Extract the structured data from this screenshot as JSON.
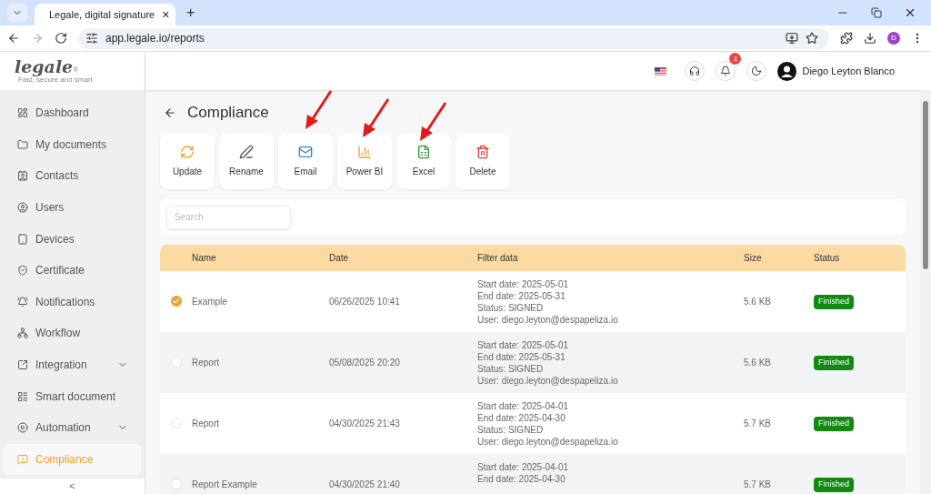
{
  "browser": {
    "tab_title": "Legale, digital signature",
    "tab_close": "×",
    "new_tab": "+",
    "url": "app.legale.io/reports",
    "profile": "D"
  },
  "logo": {
    "text": "legale",
    "mark": "®",
    "tagline": "Fast, secure and smart"
  },
  "header": {
    "notification_count": "1",
    "user_name": "Diego Leyton Blanco"
  },
  "sidebar": {
    "items": [
      {
        "kind": "dashboard",
        "label": "Dashboard",
        "expandable": false,
        "selected": false
      },
      {
        "kind": "folder",
        "label": "My documents",
        "expandable": false,
        "selected": false
      },
      {
        "kind": "contacts",
        "label": "Contacts",
        "expandable": false,
        "selected": false
      },
      {
        "kind": "users",
        "label": "Users",
        "expandable": false,
        "selected": false
      },
      {
        "kind": "devices",
        "label": "Devices",
        "expandable": false,
        "selected": false
      },
      {
        "kind": "certificate",
        "label": "Certificate",
        "expandable": false,
        "selected": false
      },
      {
        "kind": "notifications",
        "label": "Notifications",
        "expandable": false,
        "selected": false
      },
      {
        "kind": "workflow",
        "label": "Workflow",
        "expandable": false,
        "selected": false
      },
      {
        "kind": "integration",
        "label": "Integration",
        "expandable": true,
        "selected": false
      },
      {
        "kind": "smart",
        "label": "Smart document",
        "expandable": false,
        "selected": false
      },
      {
        "kind": "automation",
        "label": "Automation",
        "expandable": true,
        "selected": false
      },
      {
        "kind": "compliance",
        "label": "Compliance",
        "expandable": false,
        "selected": true
      }
    ],
    "collapse": "<"
  },
  "page": {
    "title": "Compliance",
    "actions": [
      {
        "kind": "update",
        "label": "Update"
      },
      {
        "kind": "rename",
        "label": "Rename"
      },
      {
        "kind": "email",
        "label": "Email"
      },
      {
        "kind": "powerbi",
        "label": "Power BI"
      },
      {
        "kind": "excel",
        "label": "Excel"
      },
      {
        "kind": "delete",
        "label": "Delete"
      }
    ],
    "search": {
      "placeholder": "Search"
    }
  },
  "table": {
    "columns": [
      "Name",
      "Date",
      "Filter data",
      "Size",
      "Status"
    ],
    "rows": [
      {
        "checked": true,
        "name": "Example",
        "date": "06/26/2025 10:41",
        "filter": [
          "Start date: 2025-05-01",
          "End date: 2025-05-31",
          "Status: SIGNED",
          "User: diego.leyton@despapeliza.io"
        ],
        "size": "5.6 KB",
        "status": "Finished"
      },
      {
        "checked": false,
        "name": "Report",
        "date": "05/08/2025 20:20",
        "filter": [
          "Start date: 2025-05-01",
          "End date: 2025-05-31",
          "Status: SIGNED",
          "User: diego.leyton@despapeliza.io"
        ],
        "size": "5.6 KB",
        "status": "Finished"
      },
      {
        "checked": false,
        "name": "Report",
        "date": "04/30/2025 21:43",
        "filter": [
          "Start date: 2025-04-01",
          "End date: 2025-04-30",
          "Status: SIGNED",
          "User: diego.leyton@despapeliza.io"
        ],
        "size": "5.7 KB",
        "status": "Finished"
      },
      {
        "checked": false,
        "name": "Report Example",
        "date": "04/30/2025 21:40",
        "filter": [
          "Start date: 2025-04-01",
          "End date: 2025-04-30"
        ],
        "size": "5.7 KB",
        "status": "Finished"
      }
    ]
  }
}
